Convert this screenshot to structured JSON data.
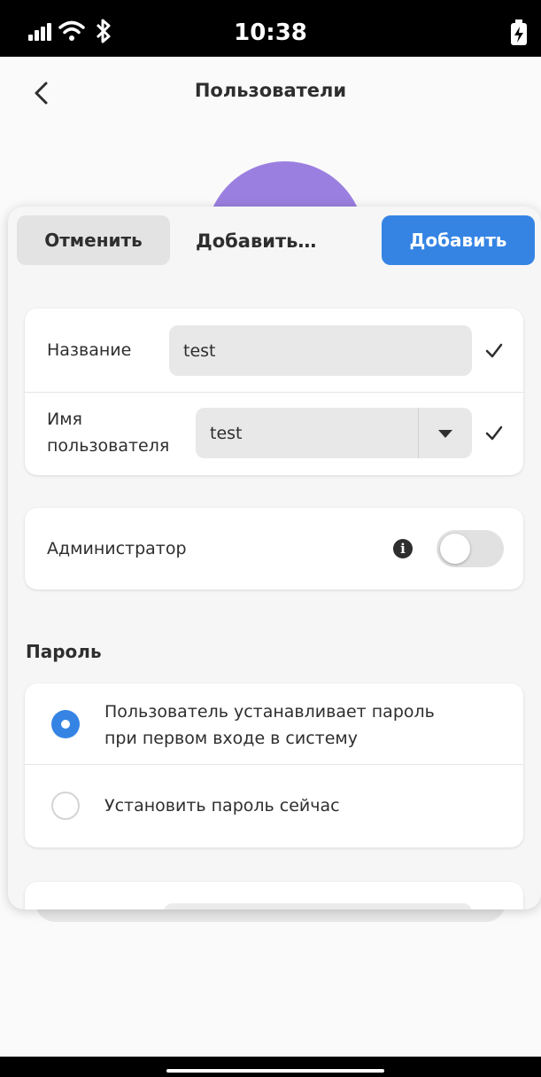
{
  "status_bar": {
    "time": "10:38",
    "icons": [
      "signal-icon",
      "wifi-icon",
      "bluetooth-icon",
      "battery-charging-icon"
    ]
  },
  "header": {
    "title": "Пользователи",
    "back_icon": "chevron-left-icon"
  },
  "sheet": {
    "cancel_label": "Отменить",
    "title": "Добавить…",
    "add_label": "Добавить"
  },
  "form": {
    "name_label": "Название",
    "name_value": "test",
    "username_label_line1": "Имя",
    "username_label_line2": "пользователя",
    "username_value": "test",
    "admin_label": "Администратор",
    "admin_enabled": false
  },
  "password": {
    "heading": "Пароль",
    "option1_line1": "Пользователь устанавливает пароль",
    "option1_line2": "при первом входе в систему",
    "option2": "Установить пароль сейчас",
    "selected": 0
  },
  "colors": {
    "accent": "#3584e4",
    "avatar": "#9b7fe0"
  }
}
